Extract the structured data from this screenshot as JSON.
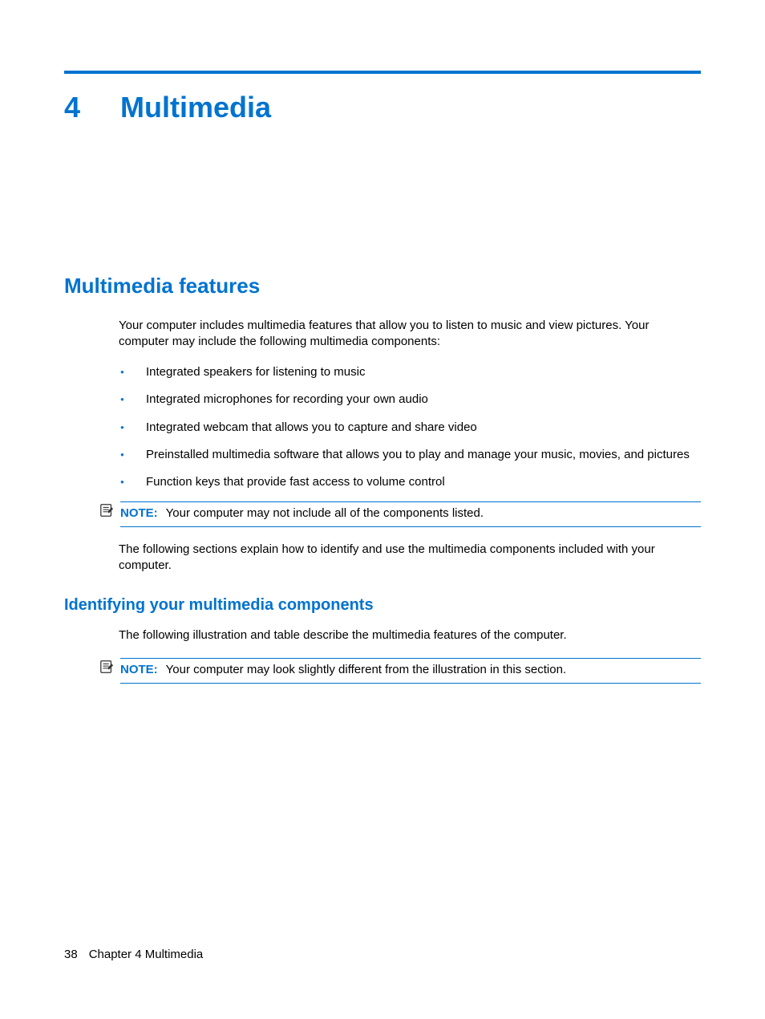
{
  "chapter": {
    "number": "4",
    "title": "Multimedia"
  },
  "section1": {
    "heading": "Multimedia features",
    "intro": "Your computer includes multimedia features that allow you to listen to music and view pictures. Your computer may include the following multimedia components:",
    "bullets": [
      "Integrated speakers for listening to music",
      "Integrated microphones for recording your own audio",
      "Integrated webcam that allows you to capture and share video",
      "Preinstalled multimedia software that allows you to play and manage your music, movies, and pictures",
      "Function keys that provide fast access to volume control"
    ],
    "note_label": "NOTE:",
    "note_text": "Your computer may not include all of the components listed.",
    "closing": "The following sections explain how to identify and use the multimedia components included with your computer."
  },
  "section2": {
    "heading": "Identifying your multimedia components",
    "intro": "The following illustration and table describe the multimedia features of the computer.",
    "note_label": "NOTE:",
    "note_text": "Your computer may look slightly different from the illustration in this section."
  },
  "footer": {
    "page_number": "38",
    "text": "Chapter 4   Multimedia"
  }
}
